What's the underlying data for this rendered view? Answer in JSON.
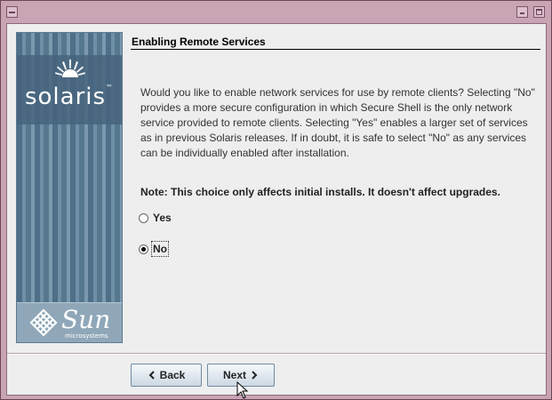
{
  "window": {
    "title": ""
  },
  "brand": {
    "product": "solaris",
    "tm": "™",
    "company": "Sun",
    "company_sub": "microsystems"
  },
  "page": {
    "heading": "Enabling Remote Services",
    "paragraph": "Would you like to enable network services for use by remote clients?  Selecting \"No\" provides a more secure configuration in which Secure Shell is the only network service provided to remote clients.  Selecting \"Yes\" enables a larger set of services as in previous Solaris releases.  If in doubt, it is safe to select \"No\" as any services can be individually enabled after installation.",
    "note": "Note: This choice only affects initial installs. It doesn't affect upgrades."
  },
  "options": [
    {
      "label": "Yes",
      "selected": false
    },
    {
      "label": "No",
      "selected": true
    }
  ],
  "buttons": {
    "back": "Back",
    "next": "Next"
  },
  "icons": {
    "window_menu": "window-menu-icon",
    "minimize": "minimize-icon",
    "maximize": "maximize-icon",
    "back_arrow": "chevron-left-icon",
    "next_arrow": "chevron-right-icon",
    "cursor": "mouse-pointer-icon"
  },
  "colors": {
    "frame": "#c9a4b4",
    "content_bg": "#eeeeee",
    "banner": "#5e7f97",
    "button_border": "#6d8aa3"
  }
}
